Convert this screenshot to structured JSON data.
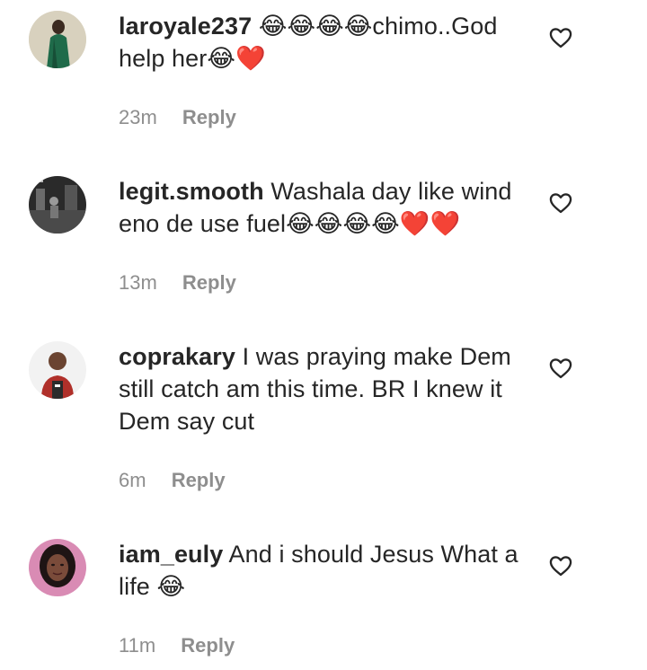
{
  "comments": [
    {
      "username": "laroyale237",
      "text": "😂😂😂😂chimo..God help her😂❤️",
      "time": "23m",
      "reply_label": "Reply",
      "avatar_icon": "avatar-woman-green-dress",
      "like_icon": "heart-outline-icon"
    },
    {
      "username": "legit.smooth",
      "text": "Washala day like wind eno de use fuel😂😂😂😂❤️❤️",
      "time": "13m",
      "reply_label": "Reply",
      "avatar_icon": "avatar-dark-scene",
      "like_icon": "heart-outline-icon"
    },
    {
      "username": "coprakary",
      "text": "I was praying make Dem still catch am this time. BR I knew it Dem say cut",
      "time": "6m",
      "reply_label": "Reply",
      "avatar_icon": "avatar-man-red-shirt",
      "like_icon": "heart-outline-icon"
    },
    {
      "username": "iam_euly",
      "text": "And i should Jesus What a life 😂",
      "time": "11m",
      "reply_label": "Reply",
      "avatar_icon": "avatar-woman-pink",
      "like_icon": "heart-outline-icon"
    }
  ],
  "colors": {
    "text": "#262626",
    "meta": "#8e8e8e",
    "background": "#ffffff"
  }
}
